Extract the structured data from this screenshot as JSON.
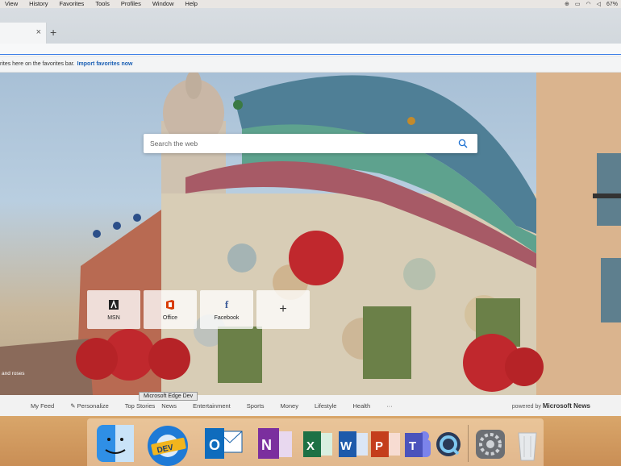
{
  "menubar": {
    "items": [
      "View",
      "History",
      "Favorites",
      "Tools",
      "Profiles",
      "Window",
      "Help"
    ],
    "battery": "67%"
  },
  "browser": {
    "new_tab_symbol": "+",
    "close_symbol": "×",
    "favorites_hint": "rites here on the favorites bar.",
    "import_link": "Import favorites now"
  },
  "search": {
    "placeholder": "Search the web"
  },
  "quick_links": [
    {
      "label": "MSN",
      "icon": "msn-icon"
    },
    {
      "label": "Office",
      "icon": "office-icon"
    },
    {
      "label": "Facebook",
      "icon": "facebook-icon"
    }
  ],
  "add_tile": "+",
  "image_caption": "and roses",
  "newsbar": {
    "items": [
      "My Feed",
      "Personalize",
      "Top Stories",
      "News",
      "Entertainment",
      "Sports",
      "Money",
      "Lifestyle",
      "Health",
      "···"
    ],
    "powered_prefix": "powered by",
    "powered_brand": "Microsoft News"
  },
  "tooltip": "Microsoft Edge Dev",
  "dock": {
    "apps": [
      "Finder",
      "Microsoft Edge Dev",
      "Outlook",
      "OneNote",
      "Excel",
      "Word",
      "PowerPoint",
      "Teams",
      "QuickTime",
      "System Preferences",
      "Trash"
    ],
    "edge_badge": "DEV"
  },
  "colors": {
    "accent": "#1a5fb4",
    "office_red": "#d83b01",
    "facebook_blue": "#3b5998"
  }
}
